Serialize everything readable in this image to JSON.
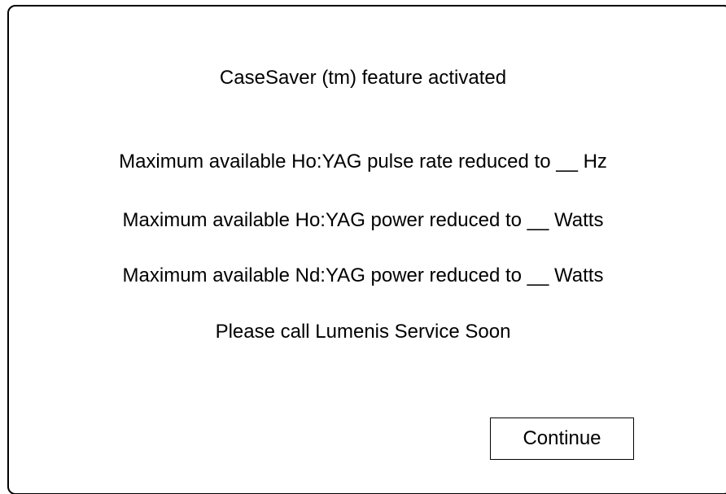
{
  "dialog": {
    "title": "CaseSaver (tm) feature activated",
    "messages": [
      "Maximum available Ho:YAG pulse rate reduced to __ Hz",
      "Maximum available Ho:YAG power reduced to __ Watts",
      "Maximum available Nd:YAG power reduced to __ Watts",
      "Please call Lumenis Service Soon"
    ],
    "continue_label": "Continue"
  },
  "colors": {
    "background": "#ffffff",
    "border": "#000000",
    "text": "#000000"
  }
}
